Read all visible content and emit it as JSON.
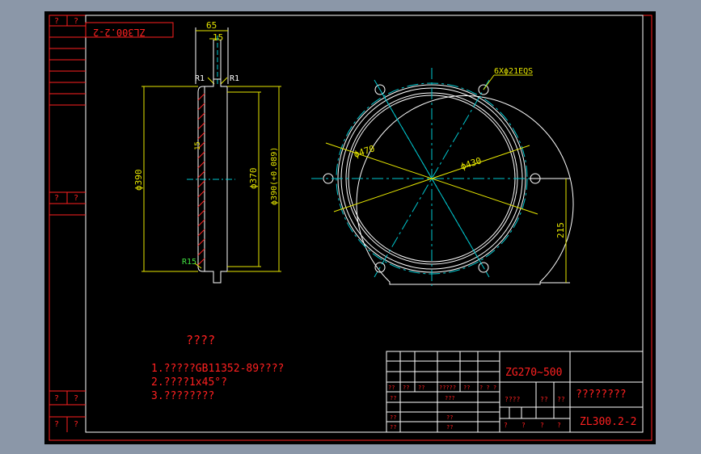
{
  "drawing": {
    "code_mirrored": "ZL300.2-2",
    "left_strip_marks": [
      "?",
      "?",
      "?",
      "?",
      "?",
      "?",
      "?",
      "?"
    ],
    "section_view": {
      "dim_top_65": "65",
      "dim_top_15": "15",
      "radius_left": "R1",
      "radius_right": "R1",
      "radius_bottom": "R15",
      "dia_390": "ϕ390",
      "dia_370": "ϕ370",
      "dia_fit": "ϕ390(+0.089)",
      "dim_small": "15"
    },
    "plan_view": {
      "holes_label": "6Xϕ21EQS",
      "dia_470": "ϕ470",
      "dia_430": "ϕ430",
      "dim_215": "215"
    },
    "notes": {
      "title": "????",
      "lines": [
        "1.?????GB11352-89????",
        "2.????1x45°?",
        "3.????????"
      ]
    },
    "title_block": {
      "material": "ZG270~500",
      "name": "????????",
      "drawing_no": "ZL300.2-2",
      "cells_row1": [
        "??",
        "??",
        "??",
        "?????",
        "??",
        "? ? ?"
      ],
      "cells_row2": [
        "??",
        "???"
      ],
      "cells_row3": [
        "??",
        "??"
      ],
      "cells_row4": [
        "??",
        "??"
      ],
      "scale_row": [
        "????",
        "??",
        "??"
      ],
      "bottom_row": [
        "?",
        "?",
        "?",
        "?"
      ]
    }
  }
}
